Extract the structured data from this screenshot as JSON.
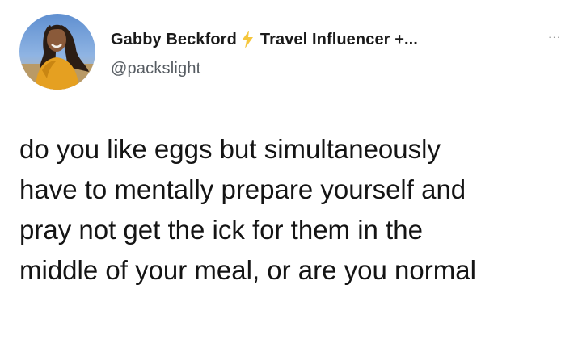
{
  "author": {
    "display_name": "Gabby Beckford",
    "bio": "Travel Influencer +...",
    "handle": "@packslight",
    "avatar_icon": "profile-photo",
    "badge_icon": "lightning-bolt-icon",
    "badge_color": "#f5c63b"
  },
  "menu": {
    "more_glyph": "···",
    "icon": "more-icon"
  },
  "tweet": {
    "lines": [
      "do you like eggs but simultaneously",
      "have to mentally prepare yourself and",
      "pray not get the ick for them in the",
      "middle of your meal, or are you normal"
    ]
  }
}
